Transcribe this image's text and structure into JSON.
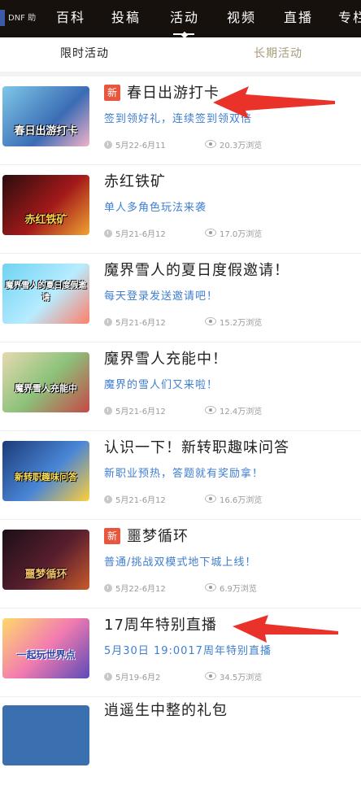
{
  "nav": {
    "logo": "DNF 助手",
    "tabs": [
      "百科",
      "投稿",
      "活动",
      "视频",
      "直播",
      "专栏"
    ],
    "active_tab": "活动"
  },
  "subtabs": {
    "left": "限时活动",
    "right": "长期活动"
  },
  "items": [
    {
      "badge": "新",
      "title": "春日出游打卡",
      "subtitle": "签到领好礼，连续签到领双倍",
      "date": "5月22-6月11",
      "views": "20.3万浏览",
      "thumb_text": "春日出游打卡"
    },
    {
      "badge": "",
      "title": "赤红铁矿",
      "subtitle": "单人多角色玩法来袭",
      "date": "5月21-6月12",
      "views": "17.0万浏览",
      "thumb_text": "赤红铁矿"
    },
    {
      "badge": "",
      "title": "魔界雪人的夏日度假邀请！",
      "subtitle": "每天登录发送邀请吧！",
      "date": "5月21-6月12",
      "views": "15.2万浏览",
      "thumb_text": "魔界雪人的夏日度假邀请"
    },
    {
      "badge": "",
      "title": "魔界雪人充能中！",
      "subtitle": "魔界的雪人们又来啦！",
      "date": "5月21-6月12",
      "views": "12.4万浏览",
      "thumb_text": "魔界雪人充能中"
    },
    {
      "badge": "",
      "title": "认识一下！新转职趣味问答",
      "subtitle": "新职业预热，答题就有奖励拿！",
      "date": "5月21-6月12",
      "views": "16.6万浏览",
      "thumb_text": "新转职趣味问答"
    },
    {
      "badge": "新",
      "title": "噩梦循环",
      "subtitle": "普通/挑战双模式地下城上线！",
      "date": "5月22-6月12",
      "views": "6.9万浏览",
      "thumb_text": "噩梦循环"
    },
    {
      "badge": "",
      "title": "17周年特别直播",
      "subtitle": "5月30日 19:0017周年特别直播",
      "date": "5月19-6月2",
      "views": "34.5万浏览",
      "thumb_text": "一起玩世界点"
    },
    {
      "badge": "",
      "title": "逍遥生中整的礼包",
      "subtitle": "",
      "date": "",
      "views": "",
      "thumb_text": ""
    }
  ],
  "colors": {
    "nav_bg": "#17110e",
    "accent_blue": "#3f7ed1",
    "badge_red": "#e8563d",
    "arrow_red": "#e8322a"
  }
}
